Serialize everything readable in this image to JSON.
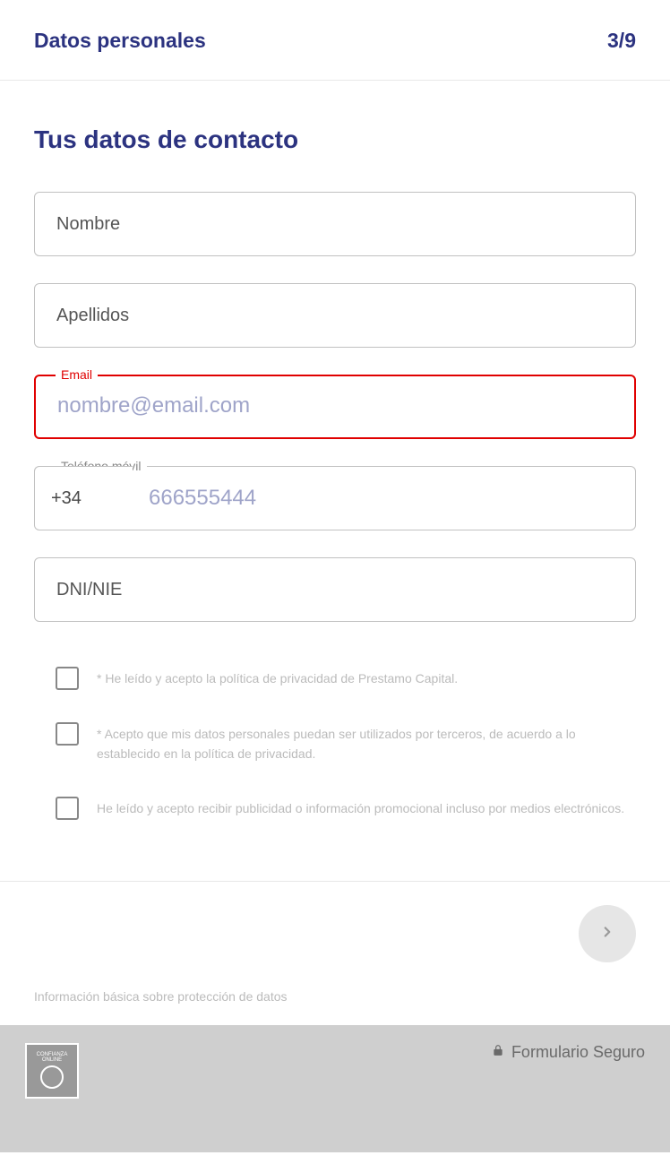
{
  "header": {
    "title": "Datos personales",
    "step": "3/9"
  },
  "section": {
    "title": "Tus datos de contacto"
  },
  "fields": {
    "nombre": {
      "placeholder": "Nombre"
    },
    "apellidos": {
      "placeholder": "Apellidos"
    },
    "email": {
      "label": "Email",
      "placeholder": "nombre@email.com"
    },
    "telefono": {
      "label": "Teléfono móvil",
      "prefix": "+34",
      "placeholder": "666555444"
    },
    "dni": {
      "placeholder": "DNI/NIE"
    }
  },
  "consents": {
    "privacy": "* He leído y acepto la política de privacidad de Prestamo Capital.",
    "thirdparty": "* Acepto que mis datos personales puedan ser utilizados por terceros, de acuerdo a lo establecido en la política de privacidad.",
    "marketing": "He leído y acepto recibir publicidad o información promocional incluso por medios electrónicos."
  },
  "legal": {
    "info": "Información básica sobre protección de datos"
  },
  "footer": {
    "secure": "Formulario Seguro",
    "badge_text": "CONFIANZA ONLINE"
  }
}
